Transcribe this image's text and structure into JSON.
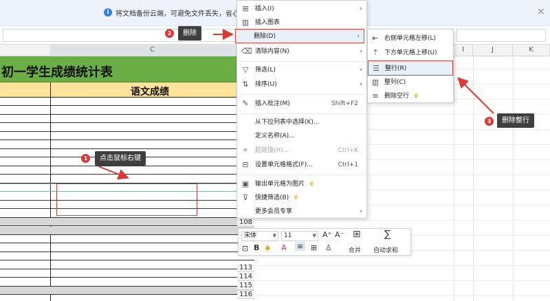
{
  "notice": {
    "message": "将文档备份云端，可避免文件丢失，省心省事",
    "info_icon": "i",
    "close": "×"
  },
  "columns": {
    "c": "C",
    "i": "I",
    "j": "J",
    "k": "K"
  },
  "sheet": {
    "title": "初一学生成绩统计表",
    "subheader": "语文成绩"
  },
  "row_numbers": [
    "108",
    "113",
    "114",
    "115",
    "116"
  ],
  "context_menu": {
    "items": [
      {
        "icon": "insert-icon",
        "glyph": "⊞",
        "label": "插入(I)",
        "arrow": "›"
      },
      {
        "icon": "chart-icon",
        "glyph": "▥",
        "label": "插入图表"
      },
      {
        "icon": "delete-icon",
        "glyph": "",
        "label": "删除(D)",
        "arrow": "›"
      },
      {
        "icon": "eraser-icon",
        "glyph": "⌫",
        "label": "清除内容(N)",
        "arrow": "›"
      },
      {
        "icon": "filter-icon",
        "glyph": "▽",
        "label": "筛选(L)",
        "arrow": "›"
      },
      {
        "icon": "sort-icon",
        "glyph": "⇅",
        "label": "排序(U)",
        "arrow": "›"
      },
      {
        "icon": "comment-icon",
        "glyph": "✎",
        "label": "插入批注(M)",
        "shortcut": "Shift+F2"
      },
      {
        "icon": "",
        "glyph": "",
        "label": "从下拉列表中选择(K)..."
      },
      {
        "icon": "",
        "glyph": "",
        "label": "定义名称(A)..."
      },
      {
        "icon": "link-icon",
        "glyph": "⚭",
        "label": "超链接(H)...",
        "shortcut": "Ctrl+K"
      },
      {
        "icon": "format-cells-icon",
        "glyph": "⊟",
        "label": "设置单元格格式(F)...",
        "shortcut": "Ctrl+1"
      },
      {
        "icon": "image-icon",
        "glyph": "▣",
        "label": "输出单元格为图片",
        "crown": "♛"
      },
      {
        "icon": "quick-filter-icon",
        "glyph": "⊽",
        "label": "快捷筛选(B)",
        "crown": "♛"
      },
      {
        "icon": "",
        "glyph": "",
        "label": "更多会员专享",
        "arrow": "›"
      }
    ]
  },
  "submenu": {
    "items": [
      {
        "icon": "shift-left-icon",
        "glyph": "⇤",
        "label": "右侧单元格左移(L)"
      },
      {
        "icon": "shift-up-icon",
        "glyph": "⇡",
        "label": "下方单元格上移(U)"
      },
      {
        "icon": "delete-row-icon",
        "glyph": "☰",
        "label": "整行(R)"
      },
      {
        "icon": "delete-column-icon",
        "glyph": "▥",
        "label": "整列(C)"
      },
      {
        "icon": "delete-empty-rows-icon",
        "glyph": "≡",
        "label": "删除空行",
        "crown": "♛"
      }
    ]
  },
  "mini_toolbar": {
    "font": "宋体",
    "size": "11",
    "grow": "A⁺",
    "shrink": "A⁻",
    "bold": "B",
    "merge": "合并",
    "autosum": "自动求和"
  },
  "annotations": {
    "step1": {
      "num": "1",
      "text": "点击鼠标右键"
    },
    "step2": {
      "num": "2",
      "text": "删除"
    },
    "step3": {
      "num": "3",
      "text": "删除整行"
    }
  },
  "colors": {
    "title_green": "#6aae45",
    "header_yellow": "#fde39b",
    "annotation_red": "#d93a35"
  }
}
